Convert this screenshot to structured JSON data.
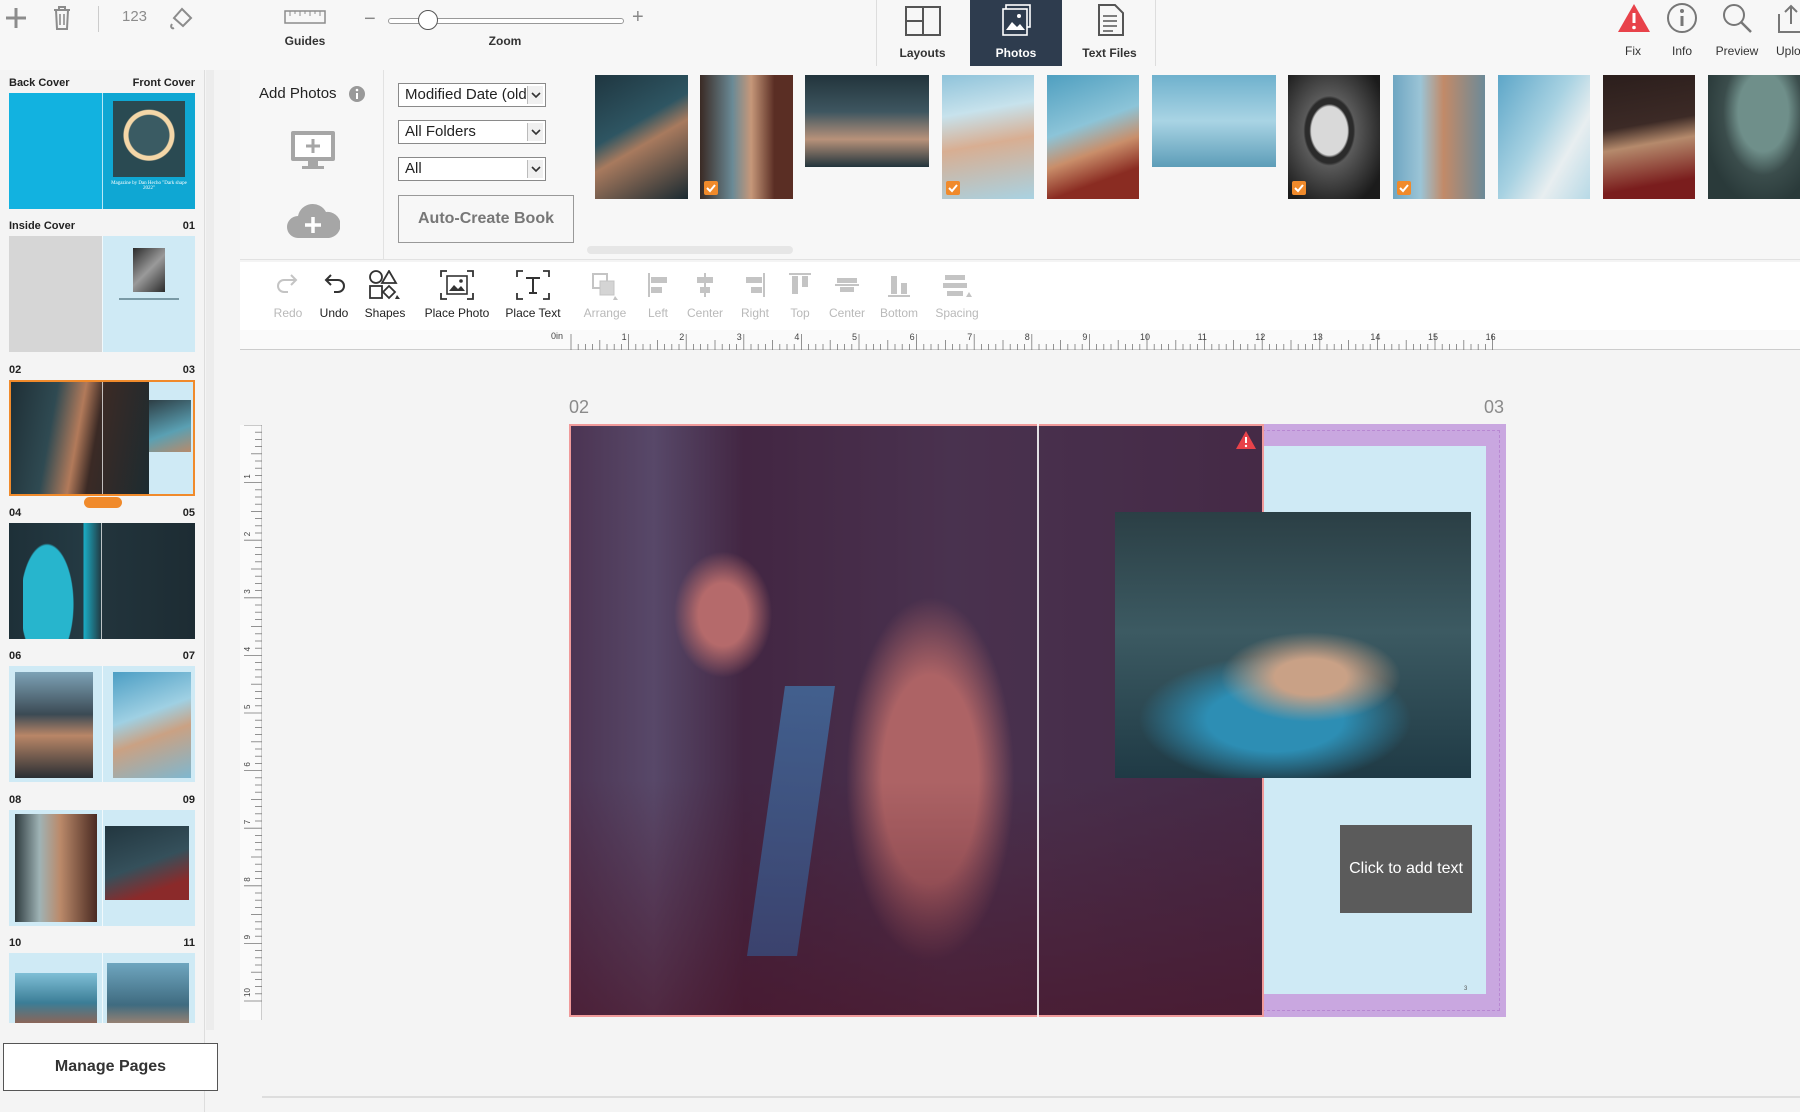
{
  "toolbar_top": {
    "count_label": "123",
    "guides_label": "Guides",
    "zoom_label": "Zoom",
    "zoom_minus": "−",
    "zoom_plus": "+",
    "zoom_level": 0.17
  },
  "tabs": [
    {
      "label": "Layouts",
      "active": false
    },
    {
      "label": "Photos",
      "active": true
    },
    {
      "label": "Text Files",
      "active": false
    }
  ],
  "right_actions": [
    {
      "label": "Fix",
      "icon": "warning-icon"
    },
    {
      "label": "Info",
      "icon": "info-icon"
    },
    {
      "label": "Preview",
      "icon": "magnifier-icon"
    },
    {
      "label": "Uplo",
      "icon": "upload-icon"
    }
  ],
  "page_panel": {
    "spreads": [
      {
        "left": "Back Cover",
        "right": "Front Cover",
        "cover_text": "Magazine by Dan Hecho \"Dark shape 2022\""
      },
      {
        "left": "Inside Cover",
        "right": "01"
      },
      {
        "left": "02",
        "right": "03"
      },
      {
        "left": "04",
        "right": "05"
      },
      {
        "left": "06",
        "right": "07"
      },
      {
        "left": "08",
        "right": "09"
      },
      {
        "left": "10",
        "right": "11"
      }
    ],
    "manage_pages": "Manage Pages"
  },
  "photos": {
    "add_photos": "Add Photos",
    "sort_select": "Modified Date (old",
    "folder_select": "All Folders",
    "filter_select": "All",
    "auto_create": "Auto-Create Book",
    "thumbnails": [
      {
        "checked": false
      },
      {
        "checked": true
      },
      {
        "checked": false
      },
      {
        "checked": true
      },
      {
        "checked": false
      },
      {
        "checked": false
      },
      {
        "checked": true
      },
      {
        "checked": true
      },
      {
        "checked": false
      },
      {
        "checked": false
      },
      {
        "checked": false
      }
    ]
  },
  "edit_tools": [
    {
      "label": "Redo",
      "enabled": false
    },
    {
      "label": "Undo",
      "enabled": true
    },
    {
      "label": "Shapes",
      "enabled": true
    },
    {
      "label": "Place Photo",
      "enabled": true
    },
    {
      "label": "Place Text",
      "enabled": true
    },
    {
      "label": "Arrange",
      "enabled": false
    },
    {
      "label": "Left",
      "enabled": false
    },
    {
      "label": "Center",
      "enabled": false
    },
    {
      "label": "Right",
      "enabled": false
    },
    {
      "label": "Top",
      "enabled": false
    },
    {
      "label": "Center",
      "enabled": false
    },
    {
      "label": "Bottom",
      "enabled": false
    },
    {
      "label": "Spacing",
      "enabled": false
    }
  ],
  "ruler": {
    "origin": "0in",
    "h_marks": [
      "1",
      "2",
      "3",
      "4",
      "5",
      "6",
      "7",
      "8",
      "9",
      "10",
      "11",
      "12",
      "13",
      "14",
      "15",
      "16"
    ],
    "v_marks": [
      "1",
      "2",
      "3",
      "4",
      "5",
      "6",
      "7",
      "8",
      "9",
      "10"
    ]
  },
  "canvas": {
    "left_page": "02",
    "right_page": "03",
    "text_placeholder": "Click to add text",
    "page_footer_number": "3"
  },
  "colors": {
    "accent": "#f08a2b",
    "tab_active": "#2e3c4e",
    "page_bg": "#cfeaf5",
    "bleed": "#c9a7e0",
    "warning": "#e8424a"
  }
}
